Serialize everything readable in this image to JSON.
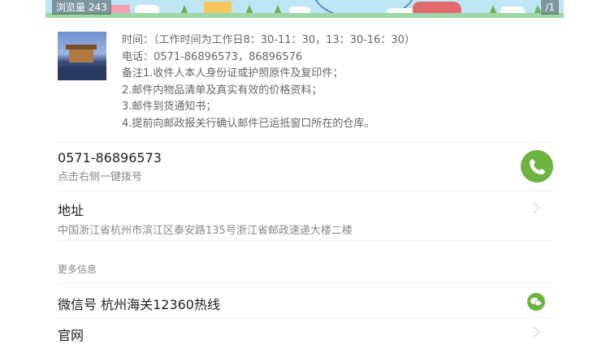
{
  "banner": {
    "views_label": "浏览量 243",
    "page_label": "/1"
  },
  "info": {
    "lines": [
      "时间：（工作时间为工作日8：30-11：30，13：30-16：30）",
      "电话：0571-86896573，86896576",
      "备注1.收件人本人身份证或护照原件及复印件；",
      "2.邮件内物品清单及真实有效的价格资料；",
      "3.邮件到货通知书；",
      "4.提前向邮政报关行确认邮件已运抵窗口所在的仓库。"
    ]
  },
  "phone": {
    "number": "0571-86896573",
    "hint": "点击右侧一键拨号"
  },
  "address": {
    "title": "地址",
    "value": "中国浙江省杭州市滨江区泰安路135号浙江省邮政速递大楼二楼"
  },
  "more": {
    "label": "更多信息",
    "wechat": "微信号 杭州海关12360热线",
    "website": "官网"
  },
  "colors": {
    "accent_green": "#6db33f"
  }
}
